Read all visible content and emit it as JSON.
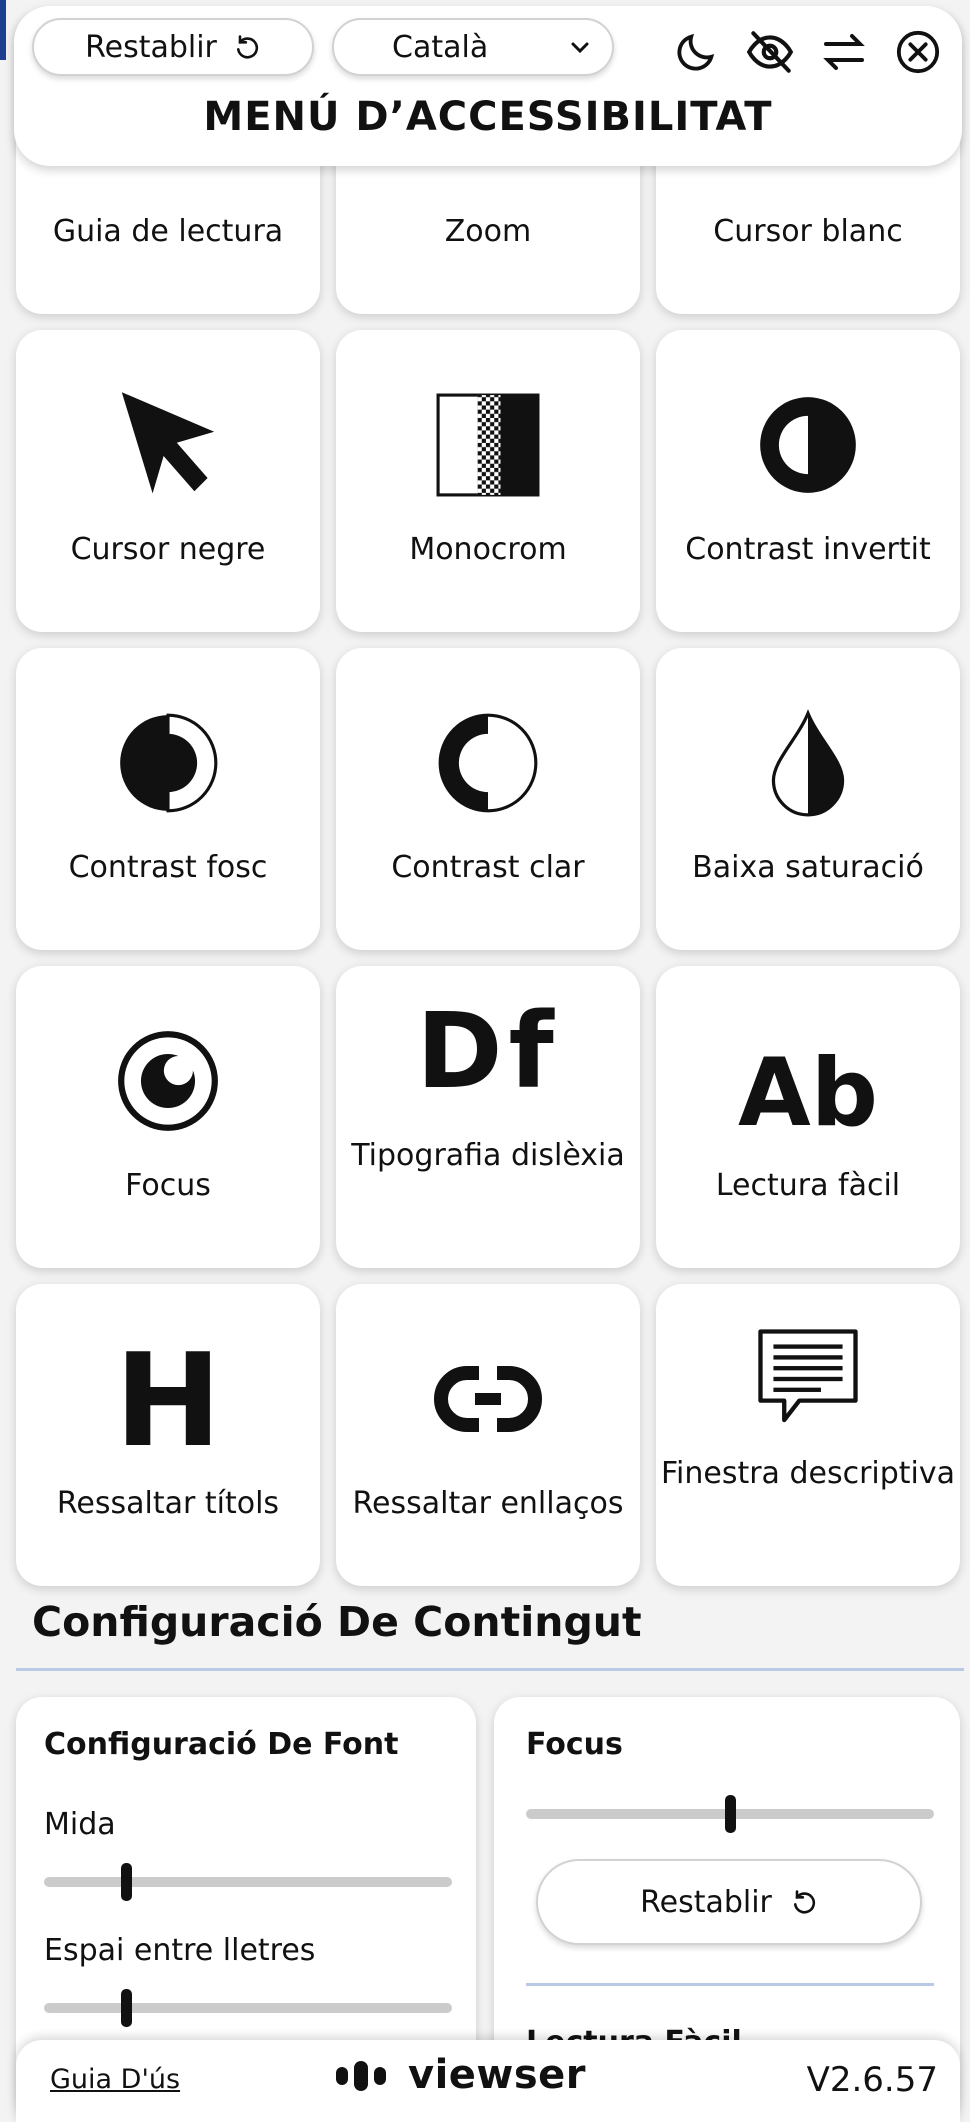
{
  "header": {
    "reset_label": "Restablir",
    "language": "Català",
    "title": "MENÚ D’ACCESSIBILITAT",
    "icons": [
      "moon-icon",
      "eye-off-icon",
      "swap-arrows-icon",
      "close-circle-icon"
    ]
  },
  "features": [
    {
      "label": "Guia de lectura",
      "icon": "reading-guide-icon"
    },
    {
      "label": "Zoom",
      "icon": "zoom-icon"
    },
    {
      "label": "Cursor blanc",
      "icon": "white-cursor-icon"
    },
    {
      "label": "Cursor negre",
      "icon": "black-cursor-icon"
    },
    {
      "label": "Monocrom",
      "icon": "monochrome-icon"
    },
    {
      "label": "Contrast invertit",
      "icon": "inverted-contrast-icon"
    },
    {
      "label": "Contrast fosc",
      "icon": "dark-contrast-icon"
    },
    {
      "label": "Contrast clar",
      "icon": "light-contrast-icon"
    },
    {
      "label": "Baixa saturació",
      "icon": "low-saturation-icon"
    },
    {
      "label": "Focus",
      "icon": "focus-icon"
    },
    {
      "label": "Tipografia dislèxia",
      "icon": "dyslexia-font-icon",
      "glyph": "Df"
    },
    {
      "label": "Lectura fàcil",
      "icon": "easy-reading-icon",
      "glyph": "Ab"
    },
    {
      "label": "Ressaltar títols",
      "icon": "highlight-titles-icon",
      "glyph": "H"
    },
    {
      "label": "Ressaltar enllaços",
      "icon": "highlight-links-icon"
    },
    {
      "label": "Finestra descriptiva",
      "icon": "descriptive-window-icon"
    }
  ],
  "content_section": {
    "title": "Configuració De Contingut",
    "font_card": {
      "title": "Configuració De Font",
      "size_label": "Mida",
      "size_value": 0.2,
      "spacing_label": "Espai entre lletres",
      "spacing_value": 0.2
    },
    "focus_card": {
      "title": "Focus",
      "focus_value": 0.5,
      "reset_label": "Restablir",
      "next_title": "Lectura Fàcil"
    }
  },
  "footer": {
    "guide_label": "Guia D'ús",
    "brand": "viewser",
    "version": "V2.6.57"
  }
}
